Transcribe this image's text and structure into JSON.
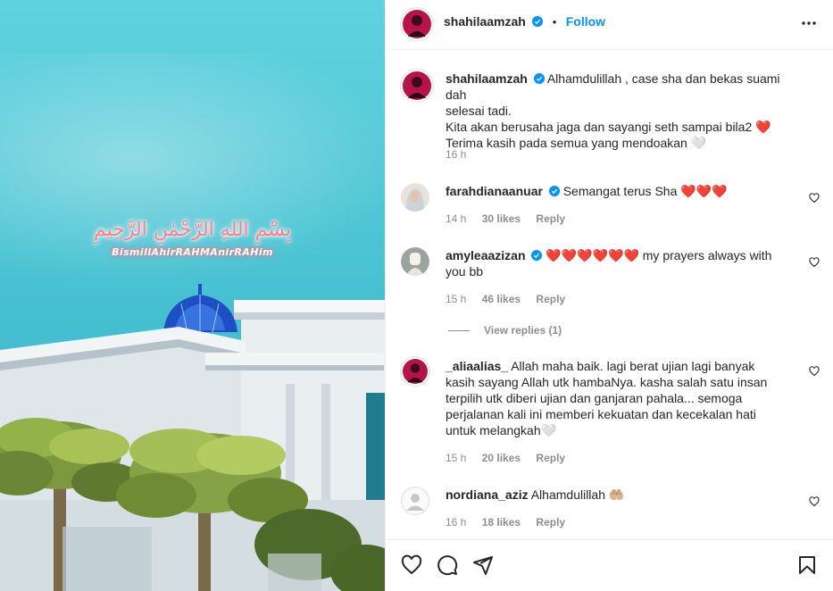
{
  "photo": {
    "arabic_text": "بِسْمِ اللهِ الرَّحْمٰنِ الرَّحِيمِ",
    "latin_text": "BismillAhirRAHMAnirRAHim"
  },
  "header": {
    "username": "shahilaamzah",
    "separator": "•",
    "follow_label": "Follow"
  },
  "post": {
    "username": "shahilaamzah",
    "caption_lines": [
      "Alhamdulillah , case sha dan bekas suami dah",
      "selesai tadi.",
      "Kita akan berusaha jaga dan sayangi seth sampai bila2 ❤️",
      "Terima kasih pada semua yang mendoakan 🤍"
    ],
    "time": "16 h"
  },
  "comments": [
    {
      "username": "farahdianaanuar",
      "text": "Semangat terus Sha ❤️❤️❤️",
      "time": "14 h",
      "likes": "30 likes",
      "reply": "Reply"
    },
    {
      "username": "amyleaazizan",
      "text_line1": "❤️❤️❤️❤️❤️❤️ my prayers always with",
      "text_line2": "you bb",
      "time": "15 h",
      "likes": "46 likes",
      "reply": "Reply",
      "view_replies": "View replies (1)"
    },
    {
      "username": "_aliaalias_",
      "text_lines": [
        "Allah maha baik. lagi berat ujian lagi banyak",
        "kasih sayang Allah utk hambaNya. kasha salah satu insan",
        "terpilih utk diberi ujian dan ganjaran pahala... semoga",
        "perjalanan kali ini memberi kekuatan dan kecekalan hati",
        "untuk melangkah🤍"
      ],
      "time": "15 h",
      "likes": "20 likes",
      "reply": "Reply"
    },
    {
      "username": "nordiana_aziz",
      "text": "Alhamdulillah 🤲🏼",
      "time": "16 h",
      "likes": "18 likes",
      "reply": "Reply"
    }
  ],
  "colors": {
    "accent": "#0095f6",
    "heart": "#ed4956",
    "muted": "#8e8e8e"
  },
  "icons": [
    "more-icon",
    "like-icon",
    "comment-icon",
    "share-icon",
    "save-icon",
    "verified-icon"
  ]
}
